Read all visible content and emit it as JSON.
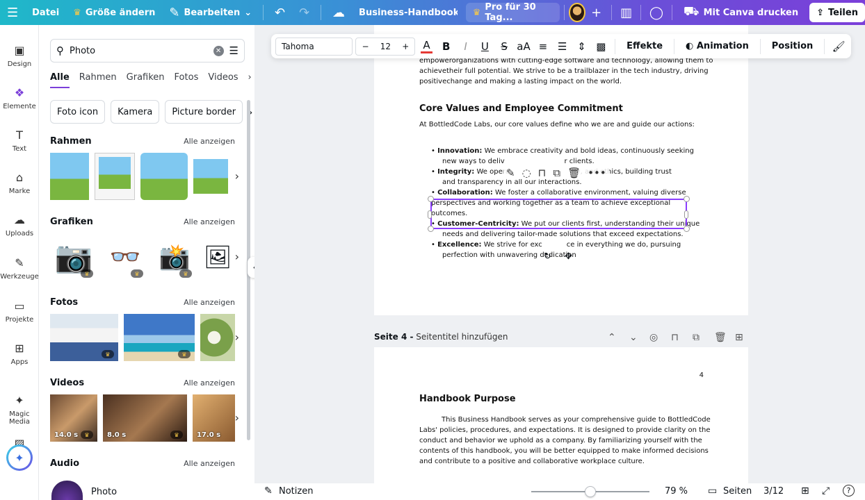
{
  "topbar": {
    "file": "Datei",
    "resize": "Größe ändern",
    "edit": "Bearbeiten",
    "doc_title": "Business-Handbook-Tem...",
    "pro_trial": "Pro für 30 Tag...",
    "print": "Mit Canva drucken",
    "share": "Teilen"
  },
  "rail": {
    "items": [
      {
        "label": "Design",
        "icon": "design-icon"
      },
      {
        "label": "Elemente",
        "icon": "elements-icon"
      },
      {
        "label": "Text",
        "icon": "text-icon"
      },
      {
        "label": "Marke",
        "icon": "brand-icon"
      },
      {
        "label": "Uploads",
        "icon": "upload-icon"
      },
      {
        "label": "Werkzeuge",
        "icon": "tools-icon"
      },
      {
        "label": "Projekte",
        "icon": "folder-icon"
      },
      {
        "label": "Apps",
        "icon": "apps-icon"
      },
      {
        "label": "Magic Media",
        "icon": "magic-media-icon"
      }
    ]
  },
  "panel": {
    "search_value": "Photo",
    "tabs": [
      "Alle",
      "Rahmen",
      "Grafiken",
      "Fotos",
      "Videos"
    ],
    "chips": [
      "Foto icon",
      "Kamera",
      "Picture border"
    ],
    "see_all": "Alle anzeigen",
    "sections": {
      "frames": "Rahmen",
      "graphics": "Grafiken",
      "photos": "Fotos",
      "videos": "Videos",
      "audio": "Audio"
    },
    "video_durations": [
      "14.0 s",
      "8.0 s",
      "17.0 s"
    ],
    "audio_item": "Photo"
  },
  "format_toolbar": {
    "font": "Tahoma",
    "size": "12",
    "effects": "Effekte",
    "animation": "Animation",
    "position": "Position"
  },
  "page3": {
    "intro_lines": [
      "empowerorganizations with cutting-edge software and technology, allowing them to",
      "achievetheir full potential. We strive to be a trailblazer in the tech industry, driving",
      "positivechange and making a lasting impact on the world."
    ],
    "heading": "Core Values and Employee Commitment",
    "lead": "At BottledCode Labs, our core values define who we are and guide our actions:",
    "values": [
      {
        "term": "Innovation:",
        "l1": "We embrace creativity and bold ideas, continuously seeking",
        "l2": "new ways to deliv                           r clients."
      },
      {
        "term": "Integrity:",
        "l1": "We opera                            ity, and ethics, building trust",
        "l2": "and transparency in all our interactions."
      },
      {
        "term": "Collaboration:",
        "l1": "We foster a collaborative environment, valuing diverse",
        "l2": "perspectives and working together as a team to achieve exceptional",
        "l3": "outcomes."
      },
      {
        "term": "Customer-Centricity:",
        "l1": "We put our clients first, understanding their unique",
        "l2": "needs and delivering tailor-made solutions that exceed expectations."
      },
      {
        "term": "Excellence:",
        "l1": "We strive for exc           ce in everything we do, pursuing",
        "l2": "perfection with unwavering dedication"
      }
    ]
  },
  "page4": {
    "label": "Seite 4 -",
    "title_placeholder": "Seitentitel hinzufügen",
    "page_number": "4",
    "heading": "Handbook Purpose",
    "body_lines": [
      "This Business Handbook serves as your comprehensive guide to BottledCode",
      "Labs' policies, procedures, and expectations. It is designed to provide clarity on the",
      "conduct and behavior we uphold as a company. By familiarizing yourself with the",
      "contents of this handbook, you will be better equipped to make informed decisions",
      "and contribute to a positive and collaborative workplace culture."
    ]
  },
  "bottombar": {
    "notes": "Notizen",
    "zoom": "79 %",
    "zoom_level": 0.5,
    "pages": "Seiten",
    "page_count": "3/12"
  },
  "colors": {
    "accent": "#8b3dff",
    "topbar_start": "#1fb8c9",
    "topbar_end": "#7b3fd9"
  }
}
